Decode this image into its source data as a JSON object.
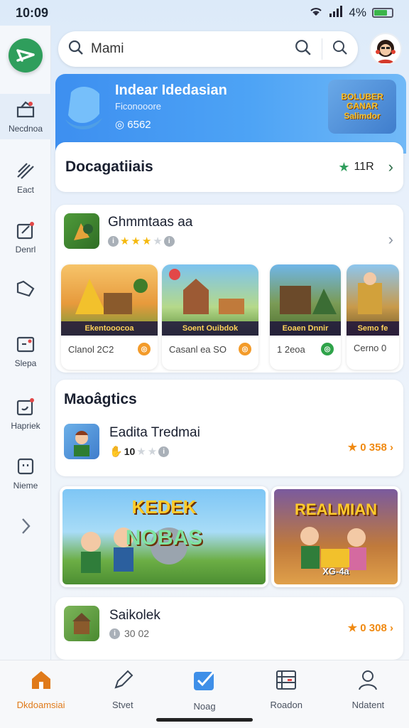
{
  "status": {
    "time": "10:09",
    "battery": "4%"
  },
  "search": {
    "value": "Mami"
  },
  "rail": {
    "items": [
      {
        "label": "Necdnoa",
        "icon": "inbox-icon"
      },
      {
        "label": "Eact",
        "icon": "pen-icon"
      },
      {
        "label": "Denrl",
        "icon": "edit-note-icon"
      },
      {
        "label": "",
        "icon": "tag-icon"
      },
      {
        "label": "Slepa",
        "icon": "note-icon"
      },
      {
        "label": "Hapriek",
        "icon": "card-icon"
      },
      {
        "label": "Nieme",
        "icon": "chat-icon"
      }
    ]
  },
  "banner": {
    "title": "Indear Idedasian",
    "subtitle": "Ficonooore",
    "count": "6562",
    "game_title": "BOLUBER\nGANAR\nSalimdor"
  },
  "categories": {
    "title": "Docagatiiais",
    "count": "11R"
  },
  "game": {
    "name": "Ghmmtaas aa",
    "rating": 3,
    "tiles": [
      {
        "band": "Ekentooocoa",
        "caption": "Clanol 2C2"
      },
      {
        "band": "Soent   Ouibdok",
        "caption": "Casanl ea SO"
      },
      {
        "band": "Eoaen      Dnnir",
        "caption": "1 2eoa"
      },
      {
        "band": "Semo   fe",
        "caption": "Cerno 0"
      }
    ]
  },
  "magagtics": {
    "title": "Maoâgtics",
    "item_name": "Eadita Tredmai",
    "item_rating": "10",
    "price": "0 358"
  },
  "promos": [
    {
      "title": "KEDEK",
      "subtitle": "NOBAS"
    },
    {
      "title": "REALMIAN",
      "subtitle": "XG-4a"
    }
  ],
  "saikolek": {
    "name": "Saikolek",
    "meta": "30 02",
    "price": "0 308"
  },
  "nav": [
    {
      "label": "Dkdoamsiai",
      "icon": "home-icon"
    },
    {
      "label": "Stvet",
      "icon": "pencil-icon"
    },
    {
      "label": "Noag",
      "icon": "checkbox-icon"
    },
    {
      "label": "Roadon",
      "icon": "calendar-icon"
    },
    {
      "label": "Ndatent",
      "icon": "user-icon"
    }
  ],
  "colors": {
    "accent": "#e07a1a",
    "brand": "#2f9e5c",
    "banner": "#3d8ff0",
    "price": "#f08a12"
  }
}
